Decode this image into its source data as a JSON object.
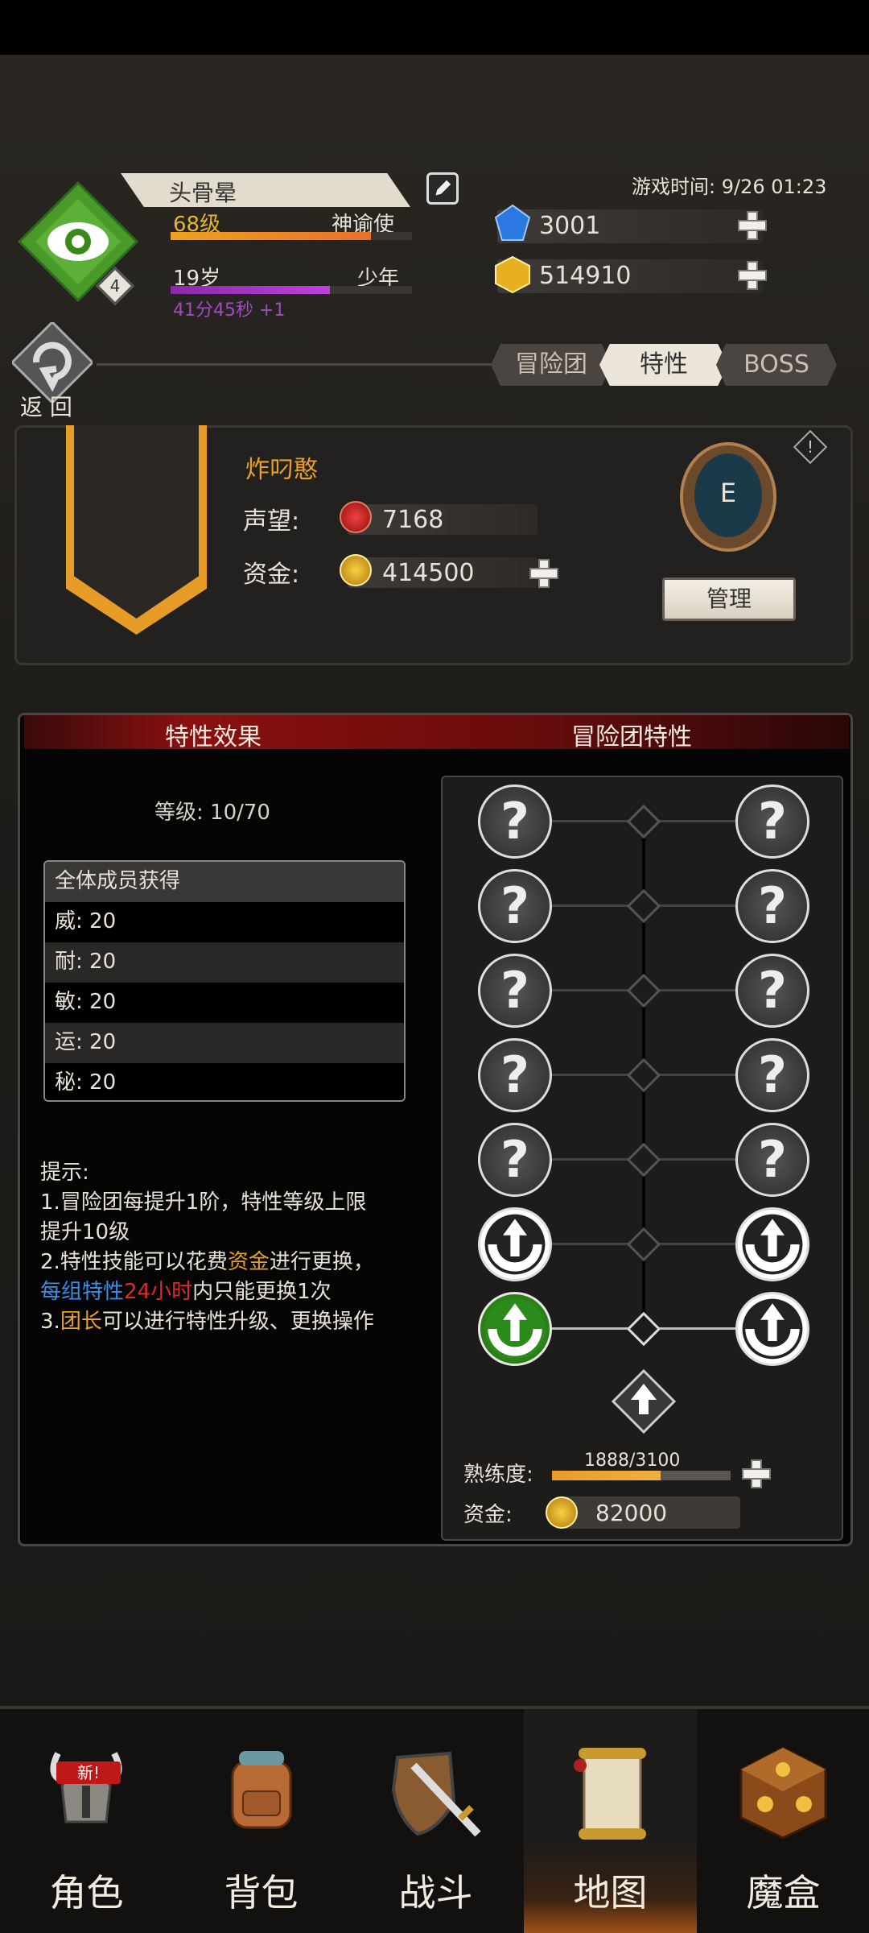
{
  "header": {
    "player_name": "头骨晕",
    "level": "68级",
    "class_title": "神谕使",
    "level_badge": "4",
    "age": "19岁",
    "age_stage": "少年",
    "timer": "41分45秒 +1",
    "game_time": "游戏时间: 9/26 01:23",
    "gems": "3001",
    "gold": "514910",
    "exp_progress": 0.83,
    "age_progress": 0.66
  },
  "nav": {
    "back_label": "返 回",
    "tabs": [
      {
        "label": "冒险团",
        "active": false
      },
      {
        "label": "特性",
        "active": true
      },
      {
        "label": "BOSS",
        "active": false
      }
    ]
  },
  "guild": {
    "name": "炸叼憨",
    "reputation_label": "声望:",
    "reputation": "7168",
    "funds_label": "资金:",
    "funds": "414500",
    "rank": "E",
    "info_icon": "!",
    "manage_label": "管理"
  },
  "traits": {
    "effect_header": "特性效果",
    "guild_header": "冒险团特性",
    "level_info": "等级: 10/70",
    "bonus": {
      "title": "全体成员获得",
      "rows": [
        "威: 20",
        "耐: 20",
        "敏: 20",
        "运: 20",
        "秘: 20"
      ]
    },
    "tips": {
      "title": "提示:",
      "line1": "1.冒险团每提升1阶，特性等级上限提升10级",
      "line2_a": "2.特性技能可以花费",
      "line2_b": "资金",
      "line2_c": "进行更换，",
      "line2_d": "每组特性",
      "line2_e": "24小时",
      "line2_f": "内只能更换1次",
      "line3_a": "3.",
      "line3_b": "团长",
      "line3_c": "可以进行特性升级、更换操作"
    },
    "locked_symbol": "?",
    "proficiency_label": "熟练度:",
    "proficiency": "1888/3100",
    "proficiency_progress": 0.61,
    "funds_label": "资金:",
    "funds": "82000"
  },
  "bottom_nav": [
    {
      "label": "角色",
      "badge": "新!"
    },
    {
      "label": "背包"
    },
    {
      "label": "战斗"
    },
    {
      "label": "地图",
      "active": true
    },
    {
      "label": "魔盒"
    }
  ],
  "colors": {
    "accent_gold": "#e8a02a",
    "exp_bar": "#f0a020",
    "age_bar": "#c040e0",
    "header_red": "#8a1010",
    "highlight_blue": "#3a8ee8",
    "highlight_red": "#e02a2a"
  },
  "icons": {
    "class_emblem": "eye-emblem-icon",
    "edit": "edit-icon",
    "gem": "blue-gem-icon",
    "gold": "gold-coin-icon",
    "back": "back-arrow-icon",
    "reputation": "reputation-medal-icon",
    "funds": "coin-icon",
    "rank": "rank-wreath-icon",
    "plus": "plus-icon"
  }
}
